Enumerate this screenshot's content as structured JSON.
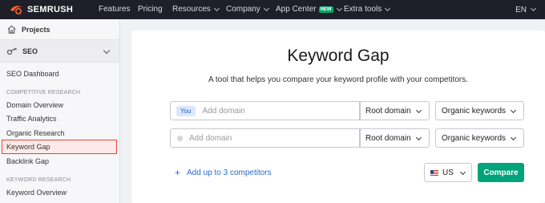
{
  "topnav": {
    "logo_text": "SEMRUSH",
    "items": [
      {
        "label": "Features",
        "dropdown": false
      },
      {
        "label": "Pricing",
        "dropdown": false
      },
      {
        "label": "Resources",
        "dropdown": true
      },
      {
        "label": "Company",
        "dropdown": true
      },
      {
        "label": "App Center",
        "dropdown": true,
        "badge": "NEW"
      },
      {
        "label": "Extra tools",
        "dropdown": true
      }
    ],
    "language": "EN"
  },
  "sidebar": {
    "projects_label": "Projects",
    "seo_label": "SEO",
    "seo_dashboard": "SEO Dashboard",
    "competitive_header": "COMPETITIVE RESEARCH",
    "competitive_items": [
      "Domain Overview",
      "Traffic Analytics",
      "Organic Research",
      "Keyword Gap",
      "Backlink Gap"
    ],
    "active_item": "Keyword Gap",
    "keyword_header": "KEYWORD RESEARCH",
    "keyword_items": [
      "Keyword Overview"
    ]
  },
  "main": {
    "title": "Keyword Gap",
    "subtitle": "A tool that helps you compare your keyword profile with your competitors.",
    "rows": [
      {
        "badge": "You",
        "placeholder": "Add domain",
        "scope": "Root domain",
        "keywords": "Organic keywords"
      },
      {
        "badge": "",
        "placeholder": "Add domain",
        "scope": "Root domain",
        "keywords": "Organic keywords"
      }
    ],
    "add_competitors": "Add up to 3 competitors",
    "country": "US",
    "compare_label": "Compare"
  },
  "colors": {
    "nav_bg": "#1f1f2a",
    "active_border": "#e8423b",
    "primary_button": "#00a37a",
    "link": "#2a6ad1"
  }
}
